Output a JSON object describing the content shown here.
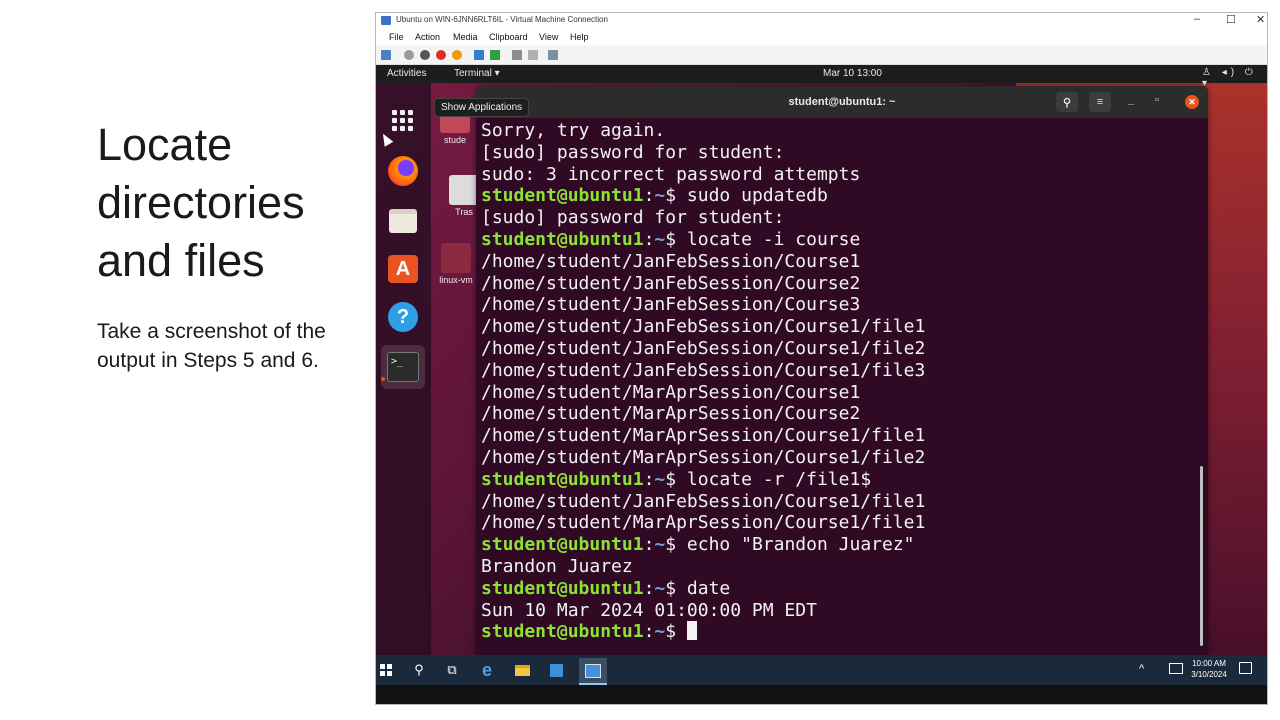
{
  "slide": {
    "title": "Locate directories and files",
    "body": "Take a screenshot of the output in Steps 5 and 6."
  },
  "vm_window": {
    "title": "Ubuntu on WIN-6JNN6RLT6IL - Virtual Machine Connection",
    "controls": {
      "minimize": "–",
      "maximize": "☐",
      "close": "✕"
    },
    "menu": [
      "File",
      "Action",
      "Media",
      "Clipboard",
      "View",
      "Help"
    ]
  },
  "ubuntu": {
    "activities": "Activities",
    "app_menu": "Terminal ▾",
    "clock": "Mar 10  13:00",
    "sys_icons": "♙ ◂) ⏻ ▾",
    "tooltip": "Show Applications",
    "desktop_icons": [
      "stude",
      "Tras",
      "linux-vm"
    ],
    "dock_software_glyph": "A",
    "dock_help_glyph": "?",
    "dock_terminal_glyph": ">_"
  },
  "terminal": {
    "title": "student@ubuntu1: ~",
    "search_glyph": "⚲",
    "menu_glyph": "≡",
    "minimize_glyph": "_",
    "maximize_glyph": "▫",
    "close_glyph": "✕",
    "prompt_user": "student@ubuntu1",
    "prompt_path": "~",
    "lines": [
      {
        "type": "output",
        "text": "Sorry, try again."
      },
      {
        "type": "output",
        "text": "[sudo] password for student:"
      },
      {
        "type": "output",
        "text": "sudo: 3 incorrect password attempts"
      },
      {
        "type": "prompt",
        "text": "$ sudo updatedb"
      },
      {
        "type": "output",
        "text": "[sudo] password for student:"
      },
      {
        "type": "prompt",
        "text": "$ locate -i course"
      },
      {
        "type": "output",
        "text": "/home/student/JanFebSession/Course1"
      },
      {
        "type": "output",
        "text": "/home/student/JanFebSession/Course2"
      },
      {
        "type": "output",
        "text": "/home/student/JanFebSession/Course3"
      },
      {
        "type": "output",
        "text": "/home/student/JanFebSession/Course1/file1"
      },
      {
        "type": "output",
        "text": "/home/student/JanFebSession/Course1/file2"
      },
      {
        "type": "output",
        "text": "/home/student/JanFebSession/Course1/file3"
      },
      {
        "type": "output",
        "text": "/home/student/MarAprSession/Course1"
      },
      {
        "type": "output",
        "text": "/home/student/MarAprSession/Course2"
      },
      {
        "type": "output",
        "text": "/home/student/MarAprSession/Course1/file1"
      },
      {
        "type": "output",
        "text": "/home/student/MarAprSession/Course1/file2"
      },
      {
        "type": "prompt",
        "text": "$ locate -r /file1$"
      },
      {
        "type": "output",
        "text": "/home/student/JanFebSession/Course1/file1"
      },
      {
        "type": "output",
        "text": "/home/student/MarAprSession/Course1/file1"
      },
      {
        "type": "prompt",
        "text": "$ echo \"Brandon Juarez\""
      },
      {
        "type": "output",
        "text": "Brandon Juarez"
      },
      {
        "type": "prompt",
        "text": "$ date"
      },
      {
        "type": "output",
        "text": "Sun 10 Mar 2024 01:00:00 PM EDT"
      },
      {
        "type": "prompt",
        "text": "$ ",
        "cursor": true
      }
    ]
  },
  "taskbar": {
    "search_glyph": "⚲",
    "taskview_glyph": "⧉",
    "edge_glyph": "e",
    "tray_chevron": "^",
    "time": "10:00 AM",
    "date": "3/10/2024"
  },
  "colors": {
    "terminal_bg": "#300a24",
    "prompt_user": "#8ae234",
    "prompt_path": "#729fcf",
    "ubuntu_accent": "#e95420"
  }
}
